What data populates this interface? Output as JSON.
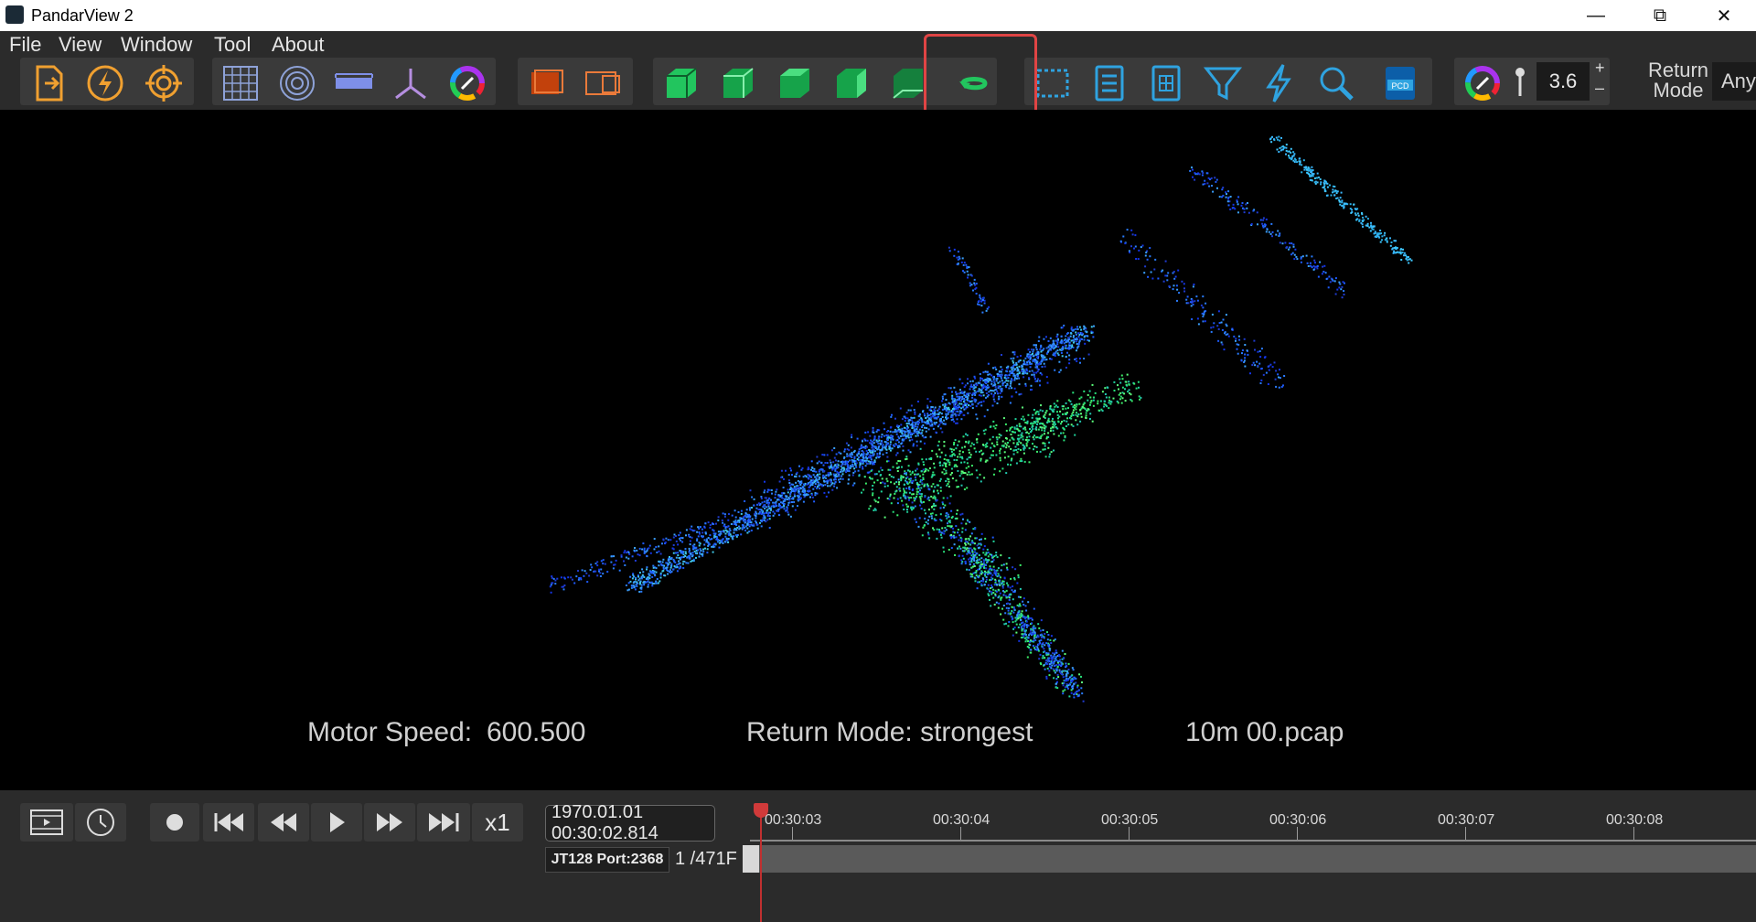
{
  "app": {
    "title": "PandarView 2"
  },
  "menu": [
    "File",
    "View",
    "Window",
    "Tool",
    "About"
  ],
  "toolbar": {
    "point_size": "3.6",
    "plus": "+",
    "minus": "–",
    "return_mode_label_1": "Return",
    "return_mode_label_2": "Mode",
    "return_mode_value": "Any"
  },
  "viewport": {
    "motor_speed_label": "Motor Speed:",
    "motor_speed_value": "600.500",
    "return_mode": "Return Mode: strongest",
    "file_name": "10m 00.pcap"
  },
  "playback": {
    "speed": "x1",
    "timestamp": "1970.01.01 00:30:02.814",
    "device": "JT128 Port:2368",
    "frame_counter": "1 /471F",
    "ticks": [
      "00:30:03",
      "00:30:04",
      "00:30:05",
      "00:30:06",
      "00:30:07",
      "00:30:08"
    ]
  },
  "colors": {
    "accent_green": "#22c55e",
    "accent_orange": "#f0a030",
    "accent_blue": "#2fa3e0",
    "highlight": "#e04444"
  }
}
